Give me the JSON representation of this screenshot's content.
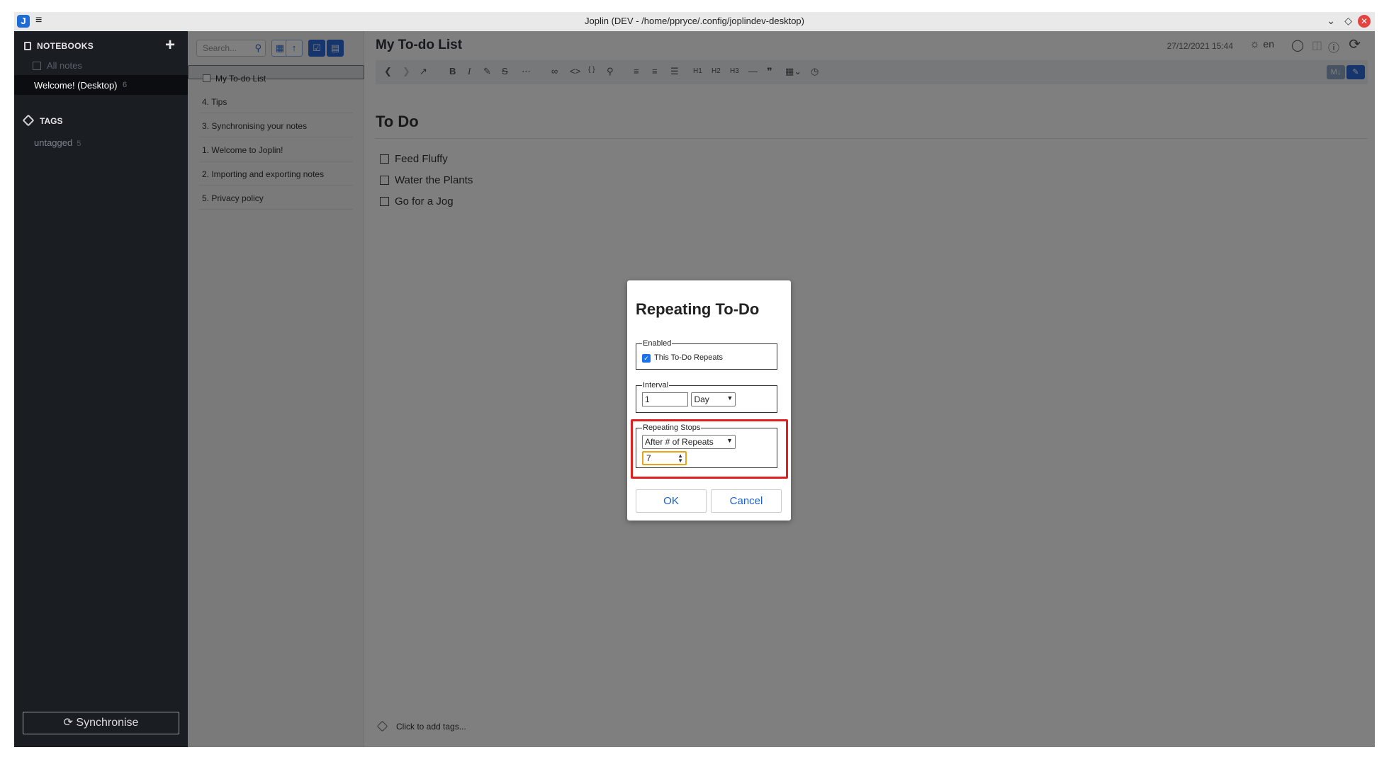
{
  "window": {
    "app_logo": "J",
    "title": "Joplin (DEV - /home/ppryce/.config/joplindev-desktop)",
    "controls": [
      "chevron-down-icon",
      "diamond-icon",
      "close-icon"
    ]
  },
  "sidebar": {
    "notebooks_header": "NOTEBOOKS",
    "add_label": "+",
    "all_notes": "All notes",
    "selected_notebook": {
      "label": "Welcome! (Desktop)",
      "count": "6"
    },
    "tags_header": "TAGS",
    "untagged": {
      "label": "untagged",
      "count": "5"
    },
    "sync_label": "Synchronise"
  },
  "notelist": {
    "search_placeholder": "Search...",
    "items": [
      {
        "title": "My To-do List",
        "is_todo": true,
        "selected": true
      },
      {
        "title": "4. Tips"
      },
      {
        "title": "3. Synchronising your notes"
      },
      {
        "title": "1. Welcome to Joplin!"
      },
      {
        "title": "2. Importing and exporting notes"
      },
      {
        "title": "5. Privacy policy"
      }
    ]
  },
  "editor": {
    "note_title": "My To-do List",
    "datetime": "27/12/2021 15:44",
    "language": "en",
    "toolbar_headings": [
      "H1",
      "H2",
      "H3"
    ],
    "heading": "To Do",
    "tasks": [
      "Feed Fluffy",
      "Water the Plants",
      "Go for a Jog"
    ],
    "tags_placeholder": "Click to add tags..."
  },
  "dialog": {
    "title": "Repeating To-Do",
    "enabled_legend": "Enabled",
    "enabled_label": "This To-Do Repeats",
    "enabled_checked": true,
    "interval_legend": "Interval",
    "interval_value": "1",
    "interval_unit": "Day",
    "stops_legend": "Repeating Stops",
    "stops_mode": "After # of Repeats",
    "stops_count": "7",
    "ok_label": "OK",
    "cancel_label": "Cancel"
  },
  "colors": {
    "accent": "#2d6bd9",
    "sidebar_bg": "#1a1d22",
    "highlight_border": "#e02020",
    "focus_border": "#e8a317"
  }
}
